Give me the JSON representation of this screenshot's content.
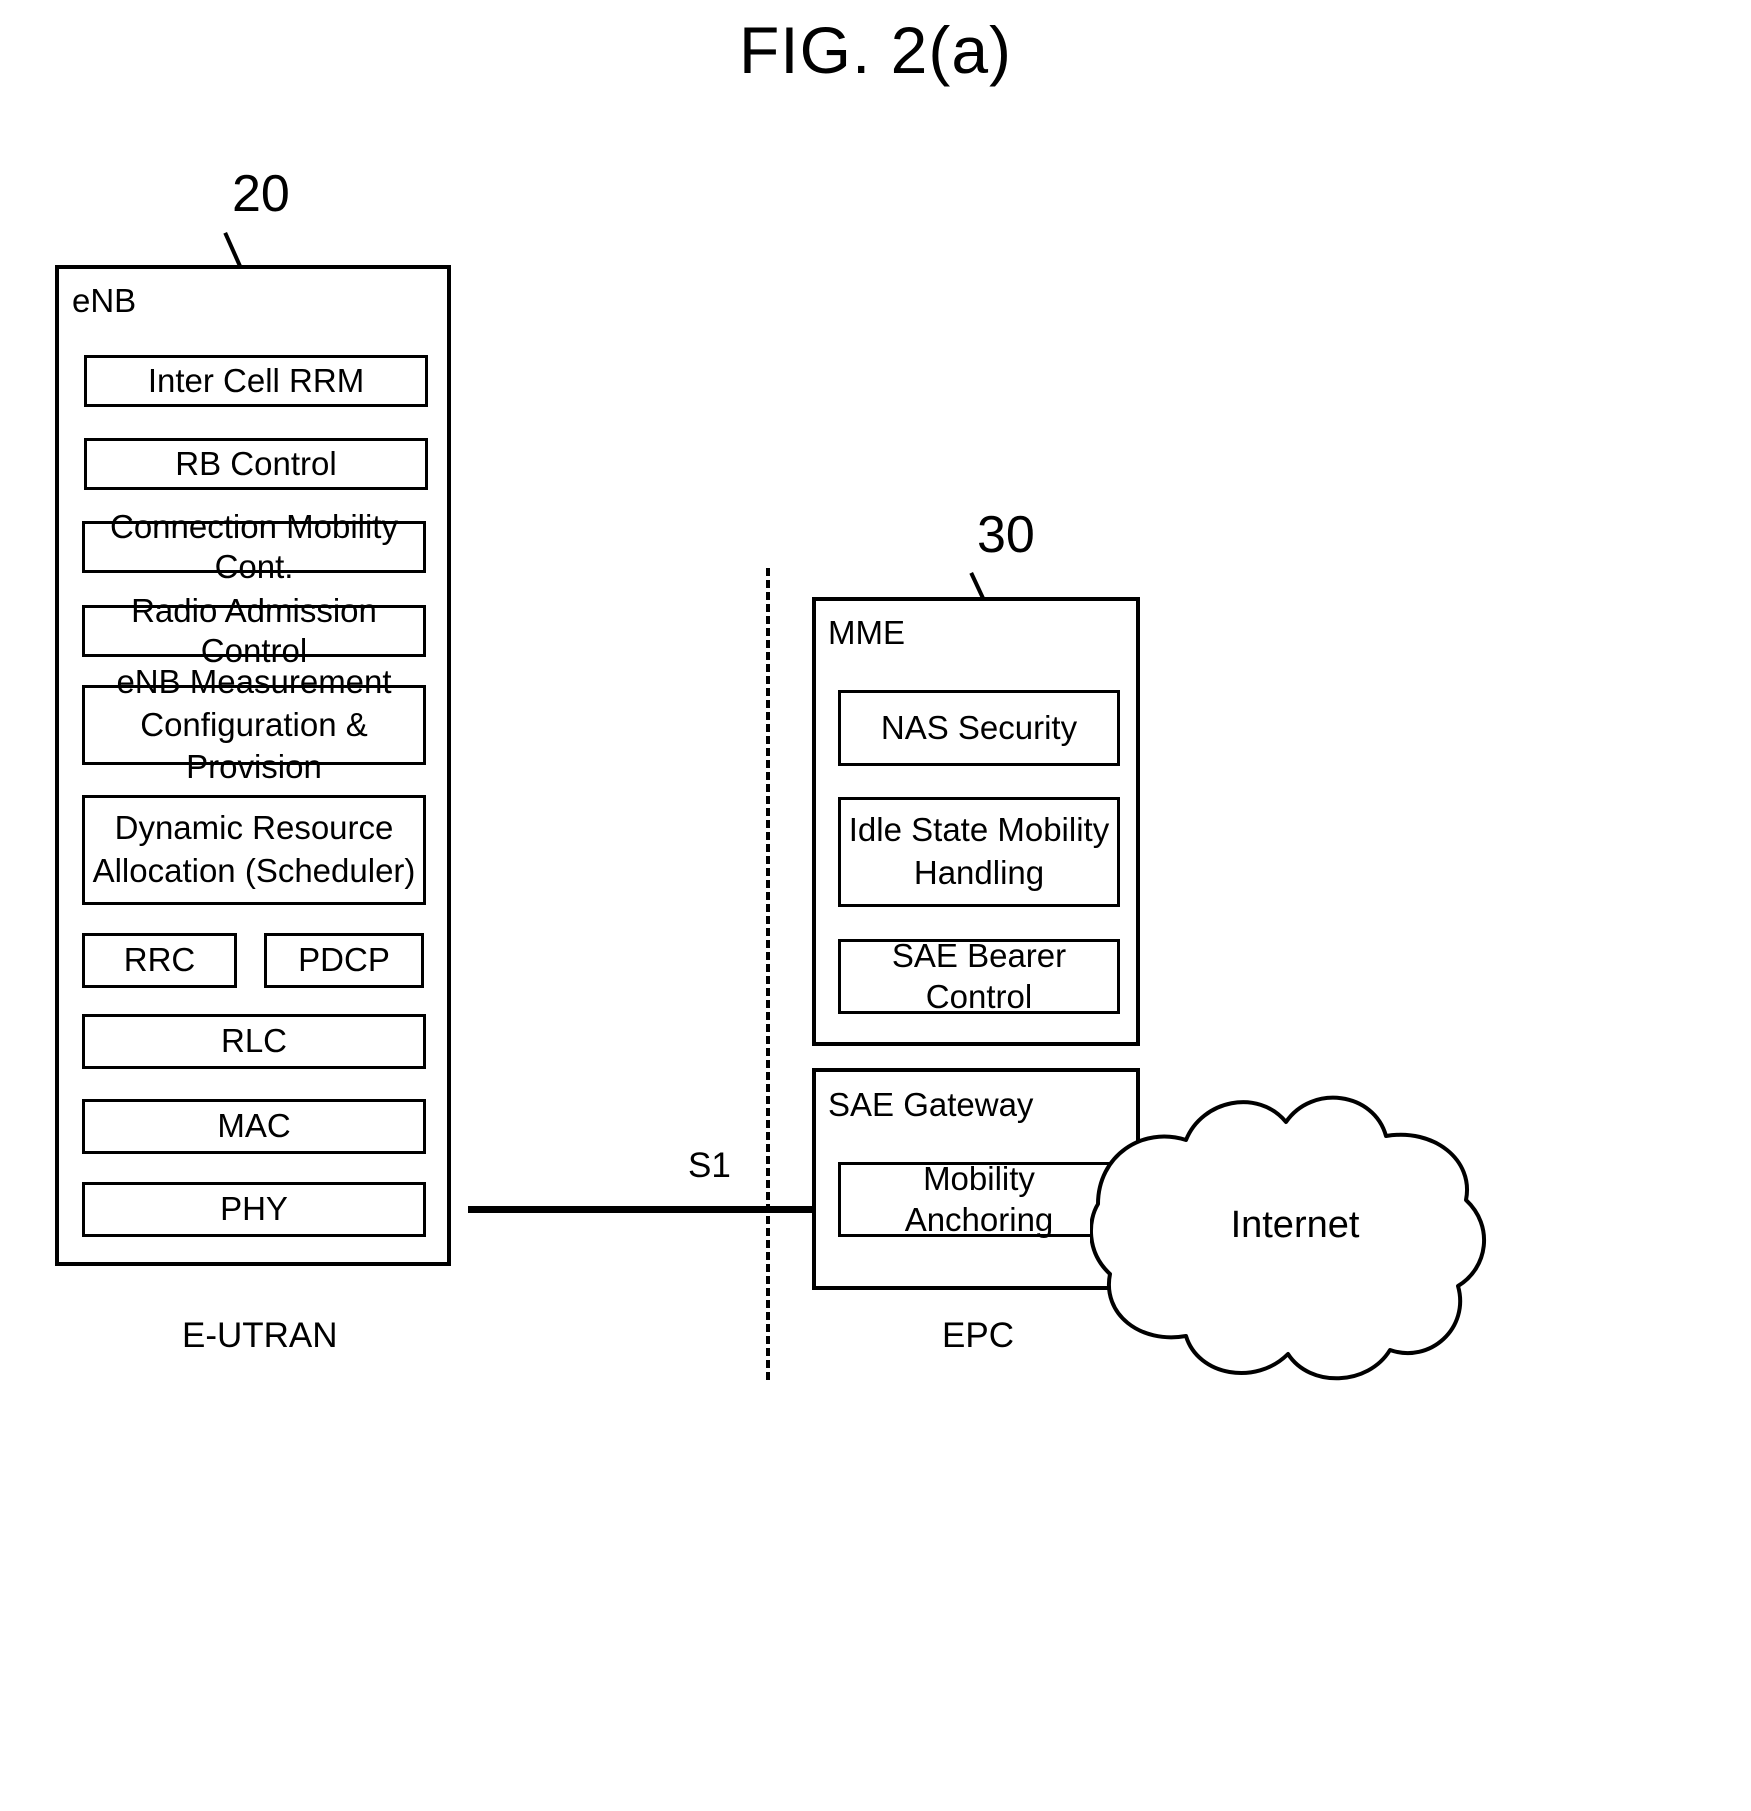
{
  "figure": {
    "title": "FIG. 2(a)"
  },
  "reference_numerals": {
    "enb": "20",
    "mme": "30"
  },
  "enb": {
    "title": "eNB",
    "blocks": [
      {
        "label": "Inter Cell RRM"
      },
      {
        "label": "RB  Control"
      },
      {
        "label": "Connection Mobility Cont."
      },
      {
        "label": "Radio Admission Control"
      },
      {
        "label_line1": "eNB Measurement",
        "label_line2": "Configuration & Provision"
      },
      {
        "label_line1": "Dynamic Resource",
        "label_line2": "Allocation (Scheduler)"
      },
      {
        "label": "RRC"
      },
      {
        "label": "PDCP"
      },
      {
        "label": "RLC"
      },
      {
        "label": "MAC"
      },
      {
        "label": "PHY"
      }
    ]
  },
  "mme": {
    "title": "MME",
    "blocks": [
      {
        "label": "NAS  Security"
      },
      {
        "label_line1": "Idle State Mobility",
        "label_line2": "Handling"
      },
      {
        "label": "SAE Bearer Control"
      }
    ]
  },
  "sae_gateway": {
    "title": "SAE Gateway",
    "blocks": [
      {
        "label": "Mobility Anchoring"
      }
    ]
  },
  "internet": {
    "label": "Internet"
  },
  "interface": {
    "s1_label": "S1"
  },
  "domains": {
    "left": "E-UTRAN",
    "right": "EPC"
  },
  "colors": {
    "stroke": "#000000",
    "background": "#ffffff"
  }
}
